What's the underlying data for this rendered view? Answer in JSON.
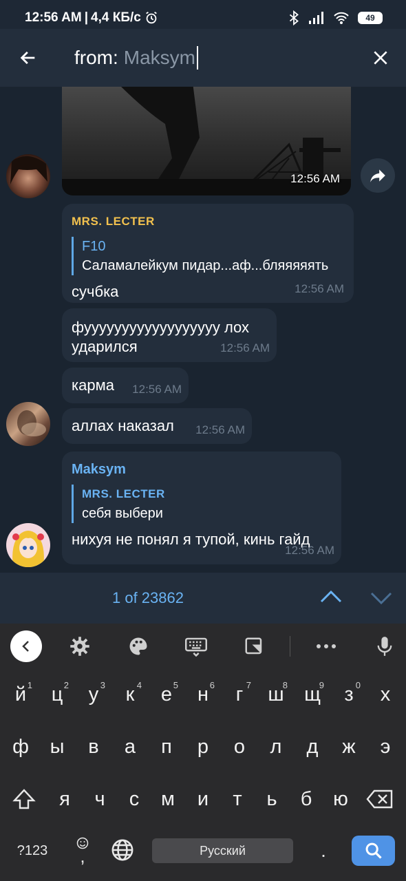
{
  "status_bar": {
    "time": "12:56 AM",
    "network_speed": "4,4 КБ/с",
    "battery": "49",
    "icons": [
      "alarm-icon",
      "bluetooth-icon",
      "signal-icon",
      "wifi-icon",
      "battery-icon"
    ]
  },
  "search": {
    "prefix": "from:",
    "query": "Maksym"
  },
  "messages": [
    {
      "time": "12:56 AM"
    },
    {
      "sender": "MRS. LECTER",
      "reply_name": "F10",
      "reply_text": "Саламалейкум пидар...аф...бляяяяять",
      "text": "сучбка",
      "time": "12:56 AM"
    },
    {
      "text_line1": "фуууууууууууууууууу лох",
      "text_line2": "ударился",
      "time": "12:56 AM"
    },
    {
      "text": "карма",
      "time": "12:56 AM"
    },
    {
      "text": "аллах наказал",
      "time": "12:56 AM"
    },
    {
      "sender": "Maksym",
      "reply_name": "MRS. LECTER",
      "reply_text": "себя выбери",
      "text": "нихуя не понял я тупой, кинь гайд",
      "time": "12:56 AM"
    }
  ],
  "search_nav": {
    "count": "1 of 23862"
  },
  "keyboard": {
    "row1": [
      {
        "k": "й",
        "h": "1"
      },
      {
        "k": "ц",
        "h": "2"
      },
      {
        "k": "у",
        "h": "3"
      },
      {
        "k": "к",
        "h": "4"
      },
      {
        "k": "е",
        "h": "5"
      },
      {
        "k": "н",
        "h": "6"
      },
      {
        "k": "г",
        "h": "7"
      },
      {
        "k": "ш",
        "h": "8"
      },
      {
        "k": "щ",
        "h": "9"
      },
      {
        "k": "з",
        "h": "0"
      },
      {
        "k": "х",
        "h": ""
      }
    ],
    "row2": [
      "ф",
      "ы",
      "в",
      "а",
      "п",
      "р",
      "о",
      "л",
      "д",
      "ж",
      "э"
    ],
    "row3": [
      "я",
      "ч",
      "с",
      "м",
      "и",
      "т",
      "ь",
      "б",
      "ю"
    ],
    "symbols_label": "?123",
    "comma": ",",
    "period": ".",
    "space_label": "Русский",
    "colors": {
      "accent": "#4f93e6",
      "link": "#6ab3f3",
      "sender_yellow": "#f2c14e"
    }
  }
}
